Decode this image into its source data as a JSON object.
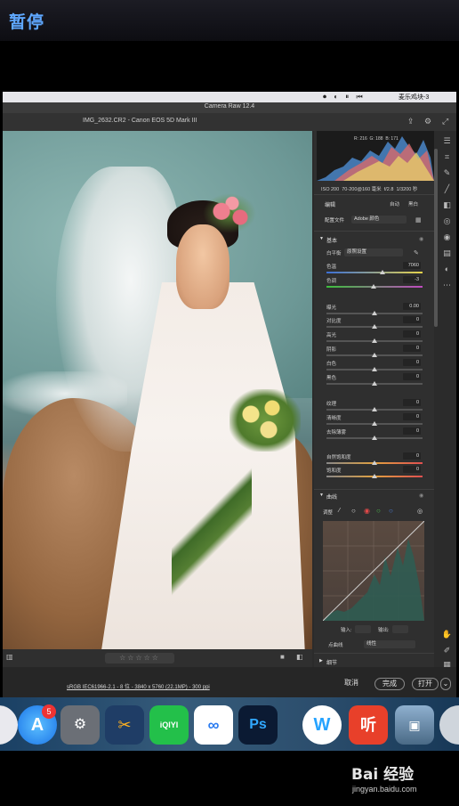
{
  "pause": {
    "title": "暂停"
  },
  "menubar": {
    "rec_controls": "⏺ ◐ ⏸ ⏮",
    "text": "麦乐鸡块-3"
  },
  "app": {
    "title": "Camera Raw 12.4",
    "file_info": "IMG_2632.CR2 - Canon EOS 5D Mark III"
  },
  "histogram": {
    "r": "R: 216",
    "g": "G: 188",
    "b": "B: 171"
  },
  "camera_info": {
    "iso": "ISO 200",
    "lens": "70-200@160 毫米",
    "aperture": "f/2.8",
    "shutter": "1/3200 秒"
  },
  "edit": {
    "title": "编辑",
    "auto": "自动",
    "bw": "黑白"
  },
  "profile": {
    "label": "配置文件",
    "value": "Adobe 颜色"
  },
  "basic": {
    "title": "基本",
    "wb_label": "白平衡",
    "wb_value": "原照设置",
    "temp": {
      "label": "色温",
      "value": "7060",
      "level": 0.58
    },
    "tint": {
      "label": "色调",
      "value": "-3",
      "level": 0.49
    },
    "exposure": {
      "label": "曝光",
      "value": "0.00",
      "level": 0.5
    },
    "contrast": {
      "label": "对比度",
      "value": "0",
      "level": 0.5
    },
    "highlights": {
      "label": "高光",
      "value": "0",
      "level": 0.5
    },
    "shadows": {
      "label": "阴影",
      "value": "0",
      "level": 0.5
    },
    "whites": {
      "label": "白色",
      "value": "0",
      "level": 0.5
    },
    "blacks": {
      "label": "黑色",
      "value": "0",
      "level": 0.5
    },
    "texture": {
      "label": "纹理",
      "value": "0",
      "level": 0.5
    },
    "clarity": {
      "label": "清晰度",
      "value": "0",
      "level": 0.5
    },
    "dehaze": {
      "label": "去除薄雾",
      "value": "0",
      "level": 0.5
    },
    "vibrance": {
      "label": "自然饱和度",
      "value": "0",
      "level": 0.5
    },
    "saturation": {
      "label": "饱和度",
      "value": "0",
      "level": 0.5
    }
  },
  "curve": {
    "title": "曲线",
    "adjust_label": "调整",
    "input_label": "输入:",
    "output_label": "输出:",
    "point_curve_label": "点曲线",
    "point_curve_value": "线性"
  },
  "detail": {
    "title": "细节"
  },
  "footer": {
    "profile_link": "sRGB IEC61966-2.1 - 8 位 - 3840 x 5760 (22.1MP) - 300 ppi",
    "cancel": "取消",
    "done": "完成",
    "open": "打开"
  },
  "rating": {
    "stars": "☆☆☆☆☆"
  },
  "dock": {
    "appstore_badge": "5",
    "ps_label": "Ps",
    "iqiyi_label": "iQIYI",
    "w_label": "W",
    "ting_label": "听"
  },
  "watermark": {
    "brand": "Bai 经验",
    "url": "jingyan.baidu.com"
  },
  "colors": {
    "accent": "#5fa8ff",
    "panel_bg": "#2f2f2f",
    "ps_blue": "#31a8ff",
    "ting_red": "#e8402a"
  }
}
